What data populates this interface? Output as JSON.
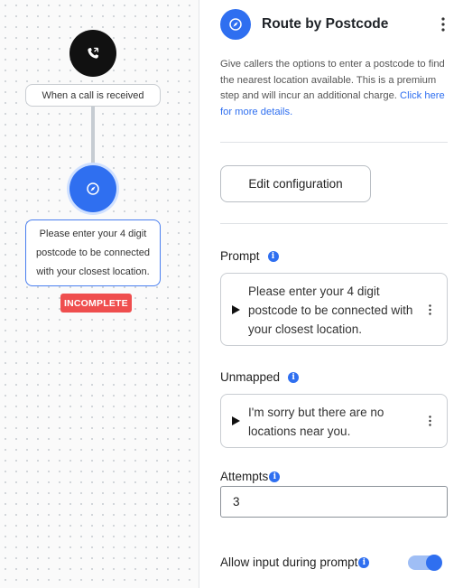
{
  "canvas": {
    "trigger_label": "When a call is received",
    "step_label": "Please enter your 4 digit postcode to be connected with your closest location.",
    "status_badge": "INCOMPLETE"
  },
  "panel": {
    "title": "Route by Postcode",
    "description": "Give callers the options to enter a postcode to find the nearest location available. This is a premium step and will incur an additional charge.",
    "description_link": "Click here for more details.",
    "edit_button": "Edit configuration",
    "prompt": {
      "label": "Prompt",
      "text": "Please enter your 4 digit postcode to be connected with your closest location."
    },
    "unmapped": {
      "label": "Unmapped",
      "text": "I'm sorry but there are no locations near you."
    },
    "attempts": {
      "label": "Attempts",
      "value": "3"
    },
    "allow_input": {
      "label": "Allow input during prompt",
      "enabled": true
    }
  },
  "icons": {
    "trigger": "phone-incoming-icon",
    "step": "compass-icon",
    "info": "info-icon",
    "menu": "kebab-menu-icon",
    "play": "play-icon"
  },
  "colors": {
    "accent": "#2f6ff0",
    "badge": "#ef4e4e",
    "trigger_node": "#111111"
  }
}
